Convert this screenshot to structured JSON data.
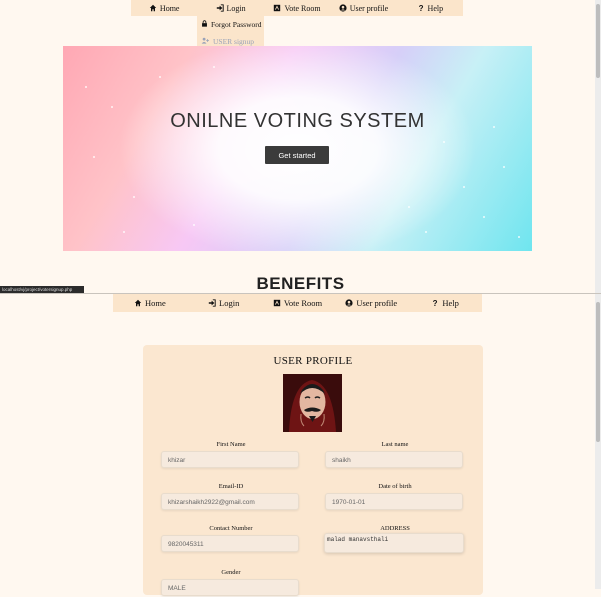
{
  "top_nav": {
    "items": [
      {
        "label": "Home",
        "icon": "home-icon"
      },
      {
        "label": "Login",
        "icon": "sign-in-icon"
      },
      {
        "label": "Vote Room",
        "icon": "ballot-icon"
      },
      {
        "label": "User profile",
        "icon": "user-circle-icon"
      },
      {
        "label": "Help",
        "icon": "question-icon"
      }
    ]
  },
  "login_dropdown": {
    "options": [
      {
        "label": "Forgot Password",
        "icon": "lock-icon"
      },
      {
        "label": "USER signup",
        "icon": "user-plus-icon"
      }
    ]
  },
  "hero": {
    "title": "ONILNE VOTING SYSTEM",
    "button_label": "Get started"
  },
  "benefits_heading": "BENEFITS",
  "status_url": "localhost/vj/project/votersignup.php",
  "second_nav": {
    "items": [
      {
        "label": "Home",
        "icon": "home-icon"
      },
      {
        "label": "Login",
        "icon": "sign-in-icon"
      },
      {
        "label": "Vote Room",
        "icon": "ballot-icon"
      },
      {
        "label": "User profile",
        "icon": "user-circle-icon"
      },
      {
        "label": "Help",
        "icon": "question-icon"
      }
    ]
  },
  "profile": {
    "title": "USER PROFILE",
    "fields": {
      "first_name": {
        "label": "First Name",
        "value": "khizar"
      },
      "last_name": {
        "label": "Last name",
        "value": "shaikh"
      },
      "email": {
        "label": "Email-ID",
        "value": "khizarshaikh2922@gmail.com"
      },
      "dob": {
        "label": "Date of birth",
        "value": "1970-01-01"
      },
      "contact": {
        "label": "Contact Number",
        "value": "9820045311"
      },
      "address": {
        "label": "ADDRESS",
        "value": "malad manavsthali"
      },
      "gender": {
        "label": "Gender",
        "value": "MALE"
      }
    }
  },
  "colors": {
    "nav_bg": "#fbe5cb",
    "page_bg": "#fff8f0",
    "button_bg": "#3b3b3b",
    "card_bg": "#fbe7d0"
  }
}
